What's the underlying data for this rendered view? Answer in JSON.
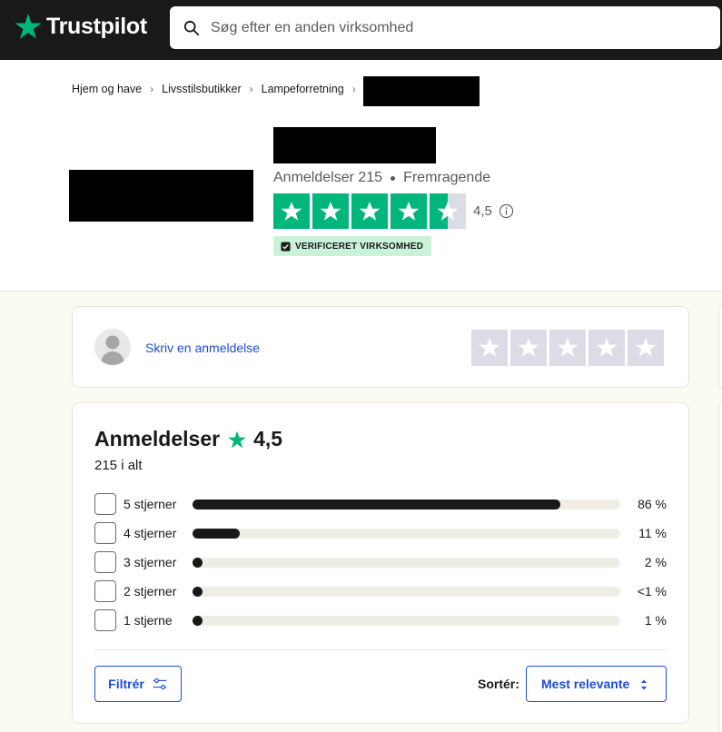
{
  "header": {
    "logo_text": "Trustpilot",
    "search_placeholder": "Søg efter en anden virksomhed"
  },
  "breadcrumb": [
    "Hjem og have",
    "Livsstilsbutikker",
    "Lampeforretning"
  ],
  "business": {
    "reviews_label": "Anmeldelser 215",
    "rating_word": "Fremragende",
    "score": "4,5",
    "stars_rating": 4.5,
    "verified_badge": "VERIFICERET VIRKSOMHED"
  },
  "write_review": {
    "link_label": "Skriv en anmeldelse"
  },
  "reviews": {
    "title": "Anmeldelser",
    "score": "4,5",
    "total": "215 i alt",
    "distribution": [
      {
        "label": "5 stjerner",
        "pct_text": "86 %",
        "fraction": 0.86
      },
      {
        "label": "4 stjerner",
        "pct_text": "11 %",
        "fraction": 0.11
      },
      {
        "label": "3 stjerner",
        "pct_text": "2 %",
        "fraction": 0.02
      },
      {
        "label": "2 stjerner",
        "pct_text": "<1 %",
        "fraction": 0.005
      },
      {
        "label": "1 stjerne",
        "pct_text": "1 %",
        "fraction": 0.01
      }
    ],
    "filter_label": "Filtrér",
    "sort_label": "Sortér:",
    "sort_value": "Mest relevante"
  },
  "colors": {
    "brand_green": "#00b67a",
    "link_blue": "#1c4fd1",
    "header_bg": "#191919",
    "verified_bg": "#c9f2d9"
  },
  "icons": [
    "trustpilot-star-icon",
    "search-icon",
    "info-icon",
    "verified-check-icon",
    "avatar-icon",
    "filter-icon",
    "sort-caret-icon"
  ]
}
